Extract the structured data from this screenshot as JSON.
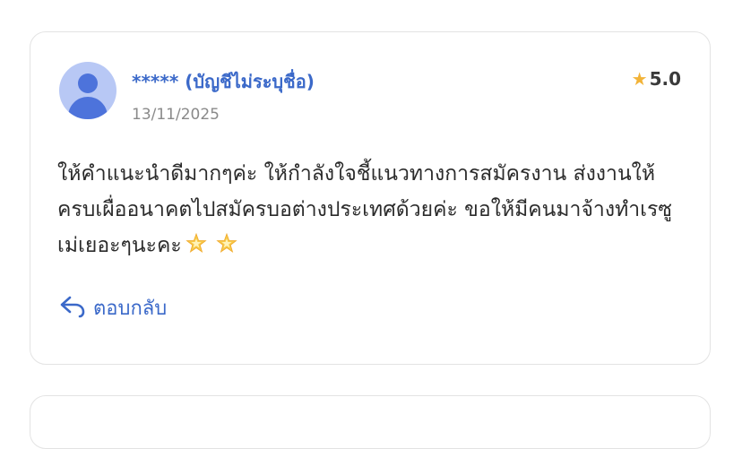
{
  "review": {
    "username": "***** (บัญชีไม่ระบุชื่อ)",
    "date": "13/11/2025",
    "rating": "5.0",
    "text": "ให้คำแนะนำดีมากๆค่ะ ให้กำลังใจชี้แนวทางการสมัครงาน ส่งงานให้ครบเผื่ออนาคตไปสมัครบอต่างประเทศด้วยค่ะ ขอให้มีคนมาจ้างทำเรซูเม่เยอะๆนะคะ",
    "emojis": [
      "glowing-star-icon",
      "glowing-star-icon"
    ],
    "reply_label": "ตอบกลับ"
  },
  "colors": {
    "accent": "#3b69c9",
    "avatar_bg": "#b8c8f5",
    "avatar_fg": "#4d73db",
    "star": "#f2b338",
    "date": "#8a8a8a",
    "border": "#e3e3e3"
  }
}
